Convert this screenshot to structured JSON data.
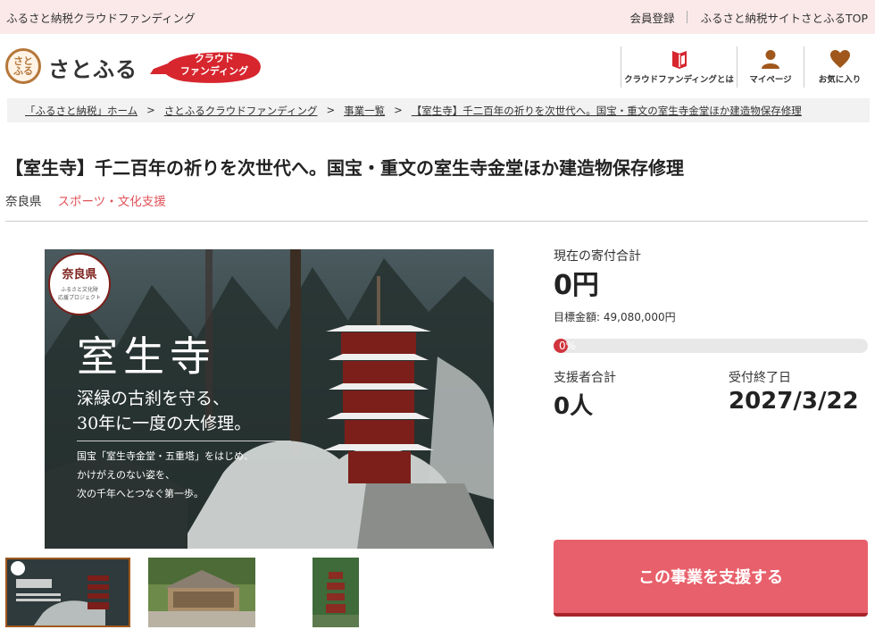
{
  "topbar": {
    "site_name": "ふるさと納税クラウドファンディング",
    "links": [
      "会員登録",
      "ふるさと納税サイトさとふるTOP"
    ]
  },
  "header": {
    "logo_mark": "さと\nふる",
    "logo_text": "さとふる",
    "badge_line1": "クラウド",
    "badge_line2": "ファンディング",
    "nav": [
      {
        "label": "クラウドファンディングとは",
        "icon": "book-icon"
      },
      {
        "label": "マイページ",
        "icon": "user-icon"
      },
      {
        "label": "お気に入り",
        "icon": "heart-icon"
      }
    ]
  },
  "breadcrumb": [
    "「ふるさと納税」ホーム",
    "さとふるクラウドファンディング",
    "事業一覧",
    "【室生寺】千二百年の祈りを次世代へ。国宝・重文の室生寺金堂ほか建造物保存修理"
  ],
  "breadcrumb_sep": ">",
  "project": {
    "title": "【室生寺】千二百年の祈りを次世代へ。国宝・重文の室生寺金堂ほか建造物保存修理",
    "prefecture": "奈良県",
    "category": "スポーツ・文化支援"
  },
  "main_image": {
    "seal_top": "奈良県",
    "seal_sub1": "ふるさと文化財",
    "seal_sub2": "応援プロジェクト",
    "headline": "室生寺",
    "sub1": "深緑の古刹を守る、",
    "sub2": "30年に一度の大修理。",
    "body1": "国宝「室生寺金堂・五重塔」をはじめ、",
    "body2": "かけがえのない姿を、",
    "body3": "次の千年へとつなぐ第一歩。"
  },
  "funding": {
    "current_label": "現在の寄付合計",
    "current_value": "0円",
    "target_label": "目標金額",
    "target_value": "49,080,000円",
    "progress_text": "0%",
    "progress_fraction": 0,
    "supporters_label": "支援者合計",
    "supporters_value": "0人",
    "deadline_label": "受付終了日",
    "deadline_value": "2027/3/22",
    "button_label": "この事業を支援する"
  },
  "colors": {
    "topbar_bg": "#fbe9ea",
    "accent_red": "#e0535a",
    "button_bg": "#e8606b",
    "progress_fill": "#d0343c"
  }
}
